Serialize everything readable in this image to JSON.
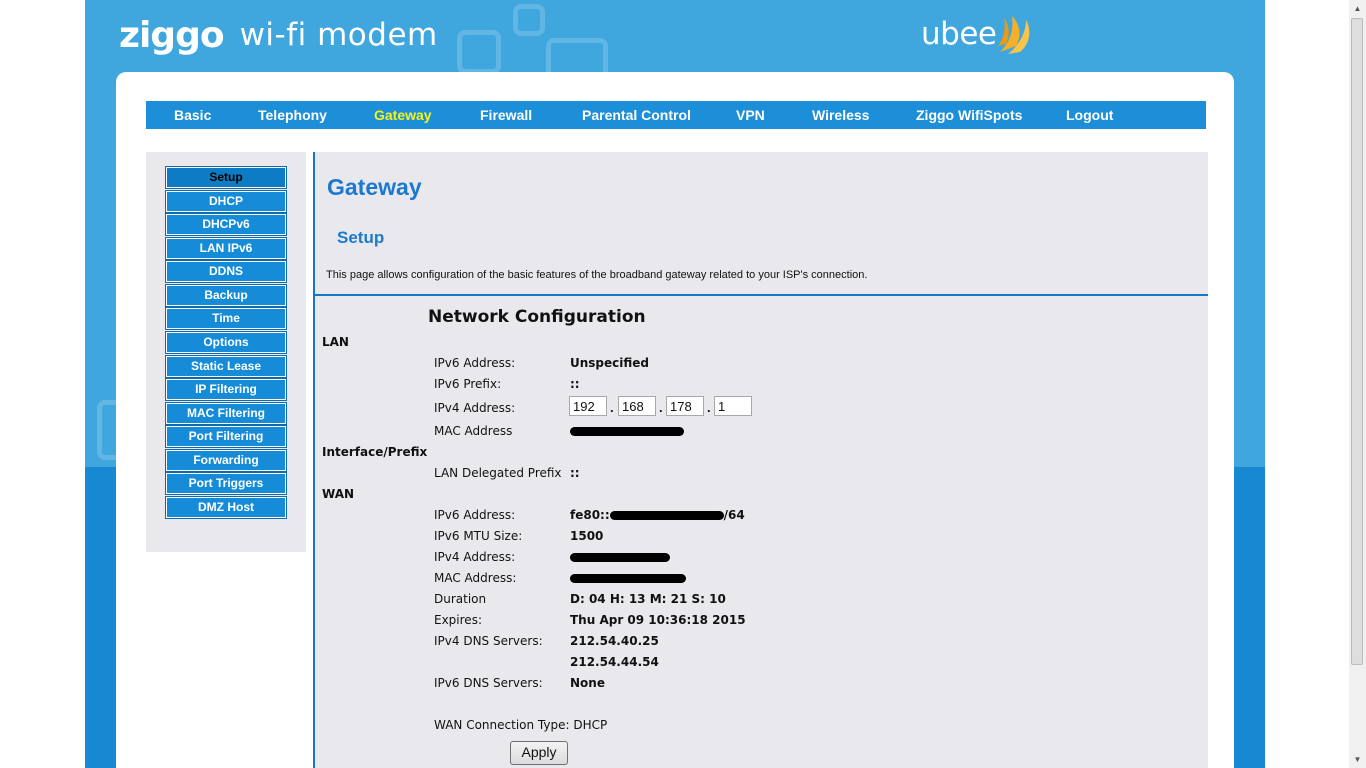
{
  "header": {
    "brand": "ziggo",
    "product": "wi-fi modem",
    "partner": "ubee"
  },
  "nav": {
    "items": [
      "Basic",
      "Telephony",
      "Gateway",
      "Firewall",
      "Parental Control",
      "VPN",
      "Wireless",
      "Ziggo WifiSpots",
      "Logout"
    ],
    "active": "Gateway",
    "active_color": "#f5f31c"
  },
  "sidebar": {
    "items": [
      "Setup",
      "DHCP",
      "DHCPv6",
      "LAN IPv6",
      "DDNS",
      "Backup",
      "Time",
      "Options",
      "Static Lease",
      "IP Filtering",
      "MAC Filtering",
      "Port Filtering",
      "Forwarding",
      "Port Triggers",
      "DMZ Host"
    ],
    "active": "Setup"
  },
  "content": {
    "title": "Gateway",
    "subtitle": "Setup",
    "description": "This page allows configuration of the basic features of the broadband gateway related to your ISP's connection.",
    "section_title": "Network Configuration",
    "lan": {
      "heading": "LAN",
      "ipv6_address_label": "IPv6 Address:",
      "ipv6_address_value": "Unspecified",
      "ipv6_prefix_label": "IPv6 Prefix:",
      "ipv6_prefix_value": "::",
      "ipv4_address_label": "IPv4 Address:",
      "ipv4_octets": [
        "192",
        "168",
        "178",
        "1"
      ],
      "mac_label": "MAC Address"
    },
    "interface": {
      "heading": "Interface/Prefix",
      "delegated_label": "LAN Delegated Prefix",
      "delegated_value": "::"
    },
    "wan": {
      "heading": "WAN",
      "ipv6_address_label": "IPv6 Address:",
      "ipv6_address_prefix": "fe80::",
      "ipv6_address_suffix": "/64",
      "mtu_label": "IPv6 MTU Size:",
      "mtu_value": "1500",
      "ipv4_address_label": "IPv4 Address:",
      "mac_label": "MAC Address:",
      "duration_label": "Duration",
      "duration_value": "D: 04 H: 13 M: 21 S: 10",
      "expires_label": "Expires:",
      "expires_value": "Thu Apr 09 10:36:18 2015",
      "dns4_label": "IPv4 DNS Servers:",
      "dns4_values": [
        "212.54.40.25",
        "212.54.44.54"
      ],
      "dns6_label": "IPv6 DNS Servers:",
      "dns6_value": "None",
      "conn_type": "WAN Connection Type: DHCP"
    },
    "apply_label": "Apply"
  },
  "colors": {
    "background_blue": "#3fa6de",
    "nav_blue": "#1c8fd8",
    "title_blue": "#1b7ad0",
    "content_bg": "#e9e8ed"
  }
}
